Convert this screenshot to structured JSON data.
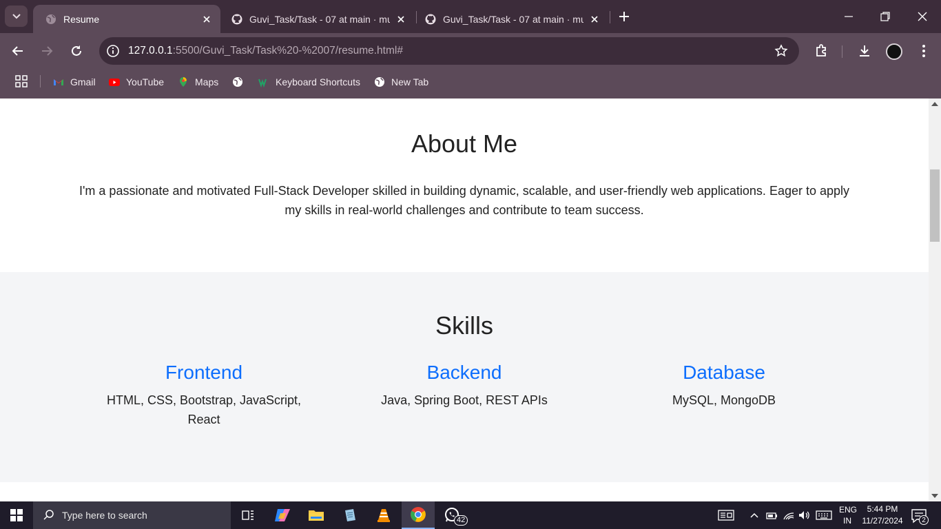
{
  "browser": {
    "tabs": [
      {
        "title": "Resume",
        "active": true
      },
      {
        "title": "Guvi_Task/Task - 07 at main · mu",
        "active": false
      },
      {
        "title": "Guvi_Task/Task - 07 at main · mu",
        "active": false
      }
    ],
    "url": {
      "host": "127.0.0.1",
      "rest": ":5500/Guvi_Task/Task%20-%2007/resume.html#"
    },
    "bookmarks": [
      "Gmail",
      "YouTube",
      "Maps",
      "Keyboard Shortcuts",
      "New Tab"
    ]
  },
  "page": {
    "about": {
      "heading": "About Me",
      "text": "I'm a passionate and motivated Full-Stack Developer skilled in building dynamic, scalable, and user-friendly web applications. Eager to apply my skills in real-world challenges and contribute to team success."
    },
    "skills": {
      "heading": "Skills",
      "items": [
        {
          "title": "Frontend",
          "text": "HTML, CSS, Bootstrap, JavaScript, React"
        },
        {
          "title": "Backend",
          "text": "Java, Spring Boot, REST APIs"
        },
        {
          "title": "Database",
          "text": "MySQL, MongoDB"
        }
      ]
    }
  },
  "taskbar": {
    "search_placeholder": "Type here to search",
    "whatsapp_badge": "42",
    "lang": {
      "line1": "ENG",
      "line2": "IN"
    },
    "time": "5:44 PM",
    "date": "11/27/2024",
    "notifications": "2"
  },
  "colors": {
    "accent_link": "#0d6efd",
    "chrome_dark": "#3c2c3a",
    "chrome_light": "#5c4a59"
  }
}
